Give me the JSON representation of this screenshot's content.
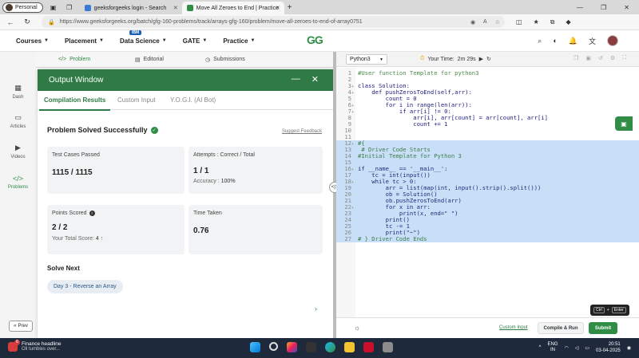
{
  "browser": {
    "profile": "Personal",
    "tabs": [
      {
        "title": "geeksforgeeks login - Search",
        "active": false
      },
      {
        "title": "Move All Zeroes to End | Practice",
        "active": true
      }
    ],
    "url": "https://www.geeksforgeeks.org/batch/gfg-160-problems/track/arrays-gfg-160/problem/move-all-zeroes-to-end-of-array0751"
  },
  "header": {
    "menu": [
      {
        "label": "Courses"
      },
      {
        "label": "Placement"
      },
      {
        "label": "Data Science",
        "badge": "IBM"
      },
      {
        "label": "GATE"
      },
      {
        "label": "Practice"
      }
    ],
    "logo": "GG"
  },
  "rail": {
    "items": [
      {
        "label": "Dash",
        "icon": "dashboard-icon"
      },
      {
        "label": "Articles",
        "icon": "book-icon"
      },
      {
        "label": "Videos",
        "icon": "video-icon"
      },
      {
        "label": "Problems",
        "icon": "code-icon",
        "active": true
      }
    ],
    "prev": "Prev"
  },
  "problem_tabs": [
    {
      "label": "Problem",
      "active": true
    },
    {
      "label": "Editorial"
    },
    {
      "label": "Submissions"
    }
  ],
  "output": {
    "title": "Output Window",
    "tabs": [
      {
        "label": "Compilation Results",
        "active": true
      },
      {
        "label": "Custom Input"
      },
      {
        "label": "Y.O.G.I. (AI Bot)"
      }
    ],
    "status": "Problem Solved Successfully",
    "feedback": "Suggest Feedback",
    "cards": {
      "tests": {
        "label": "Test Cases Passed",
        "value": "1115 / 1115"
      },
      "attempts": {
        "label": "Attempts : Correct / Total",
        "value": "1 / 1",
        "accuracy_label": "Accuracy :",
        "accuracy_value": "100%"
      },
      "points": {
        "label": "Points Scored",
        "value": "2 / 2",
        "total_label": "Your Total Score:",
        "total_value": "4"
      },
      "time": {
        "label": "Time Taken",
        "value": "0.76"
      }
    },
    "solve_next": "Solve Next",
    "next_problem": "Day 3 - Reverse an Array"
  },
  "editor": {
    "language": "Python3",
    "timer_label": "Your Time:",
    "timer_value": "2m 29s",
    "lines": [
      {
        "n": "1",
        "text": "#User function Template for python3",
        "comment": true
      },
      {
        "n": "2",
        "text": ""
      },
      {
        "n": "3",
        "fold": true,
        "text": "class Solution:"
      },
      {
        "n": "4",
        "fold": true,
        "text": "    def pushZerosToEnd(self,arr):"
      },
      {
        "n": "5",
        "text": "        count = 0"
      },
      {
        "n": "6",
        "fold": true,
        "text": "        for i in range(len(arr)):"
      },
      {
        "n": "7",
        "fold": true,
        "text": "            if arr[i] != 0:"
      },
      {
        "n": "8",
        "text": "                arr[i], arr[count] = arr[count], arr[i]"
      },
      {
        "n": "9",
        "text": "                count += 1"
      },
      {
        "n": "10",
        "text": ""
      },
      {
        "n": "11",
        "text": ""
      },
      {
        "n": "12",
        "fold": true,
        "text": "#{",
        "comment": true,
        "selected": true
      },
      {
        "n": "13",
        "text": " # Driver Code Starts",
        "comment": true,
        "selected": true
      },
      {
        "n": "14",
        "text": "#Initial Template for Python 3",
        "comment": true,
        "selected": true
      },
      {
        "n": "15",
        "text": "",
        "selected": true
      },
      {
        "n": "16",
        "fold": true,
        "text": "if __name__ == '__main__':",
        "selected": true
      },
      {
        "n": "17",
        "text": "    tc = int(input())",
        "selected": true
      },
      {
        "n": "18",
        "fold": true,
        "text": "    while tc > 0:",
        "selected": true
      },
      {
        "n": "19",
        "text": "        arr = list(map(int, input().strip().split()))",
        "selected": true
      },
      {
        "n": "20",
        "text": "        ob = Solution()",
        "selected": true
      },
      {
        "n": "21",
        "text": "        ob.pushZerosToEnd(arr)",
        "selected": true
      },
      {
        "n": "22",
        "fold": true,
        "text": "        for x in arr:",
        "selected": true
      },
      {
        "n": "23",
        "text": "            print(x, end=\" \")",
        "selected": true
      },
      {
        "n": "24",
        "text": "        print()",
        "selected": true
      },
      {
        "n": "25",
        "text": "        tc -= 1",
        "selected": true
      },
      {
        "n": "26",
        "text": "        print(\"~\")",
        "selected": true
      },
      {
        "n": "27",
        "text": "# } Driver Code Ends",
        "comment": true,
        "selected": true
      }
    ],
    "custom_input": "Custom Input",
    "compile_run": "Compile & Run",
    "submit": "Submit",
    "shortcut": {
      "k1": "Ctrl",
      "plus": "+",
      "k2": "Enter"
    }
  },
  "taskbar": {
    "news_title": "Finance headline",
    "news_sub": "Oil tumbles over...",
    "lang1": "ENG",
    "lang2": "IN",
    "time": "20:51",
    "date": "03-04-2025"
  },
  "colors": {
    "brand": "#2f8d46",
    "output_header": "#2f7a45",
    "selection": "#c8dff7"
  }
}
